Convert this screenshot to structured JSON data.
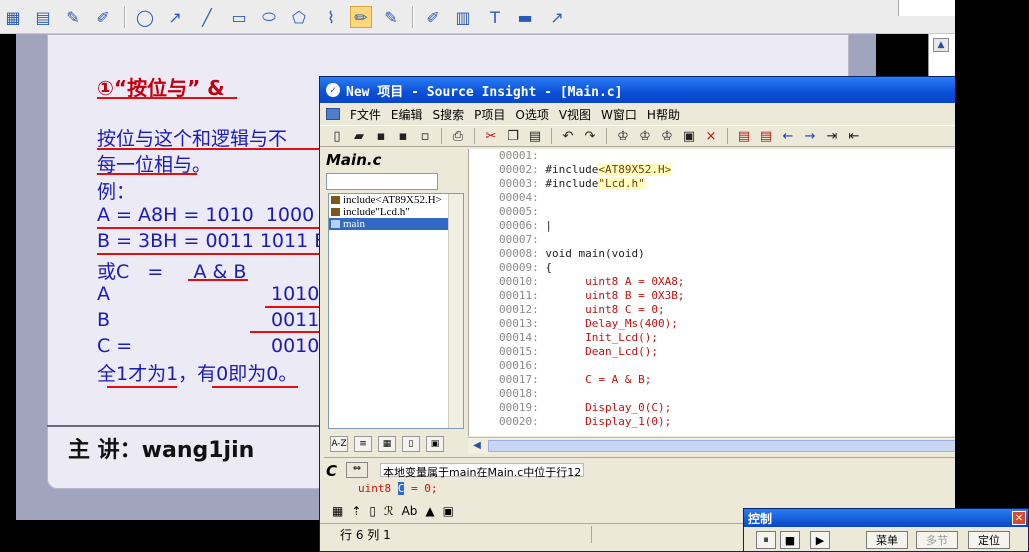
{
  "si_window": {
    "title": "New 项目 - Source Insight - [Main.c]",
    "menu": [
      "F文件",
      "E编辑",
      "S搜索",
      "P项目",
      "O选项",
      "V视图",
      "W窗口",
      "H帮助"
    ],
    "symbol_title": "Main.c",
    "symbols": [
      "include<AT89X52.H>",
      "include\"Lcd.h\"",
      "main"
    ],
    "code_lines": [
      {
        "num": "00001:",
        "text": ""
      },
      {
        "num": "00002:",
        "text": "#include<AT89X52.H>"
      },
      {
        "num": "00003:",
        "text": "#include\"Lcd.h\""
      },
      {
        "num": "00004:",
        "text": ""
      },
      {
        "num": "00005:",
        "text": ""
      },
      {
        "num": "00006:",
        "text": "|"
      },
      {
        "num": "00007:",
        "text": ""
      },
      {
        "num": "00008:",
        "text": "void main(void)"
      },
      {
        "num": "00009:",
        "text": "{"
      },
      {
        "num": "00010:",
        "text": "uint8 A = 0XA8;"
      },
      {
        "num": "00011:",
        "text": "uint8 B = 0X3B;"
      },
      {
        "num": "00012:",
        "text": "uint8 C = 0;"
      },
      {
        "num": "00013:",
        "text": "Delay_Ms(400);"
      },
      {
        "num": "00014:",
        "text": "Init_Lcd();"
      },
      {
        "num": "00015:",
        "text": "Dean_Lcd();"
      },
      {
        "num": "00016:",
        "text": ""
      },
      {
        "num": "00017:",
        "text": "C = A & B;"
      },
      {
        "num": "00018:",
        "text": ""
      },
      {
        "num": "00019:",
        "text": "Display_0(C);"
      },
      {
        "num": "00020:",
        "text": "Display_1(0);"
      }
    ],
    "context_label": "C",
    "context_text": "本地变量属于main在Main.c中位于行12",
    "context_code_before": "uint8 ",
    "context_code_sel": "C",
    "context_code_after": " = 0;",
    "status": "行 6  列 1"
  },
  "slide": {
    "title": "①“按位与” &",
    "line1": "按位与这个和逻辑与不",
    "line2": "每一位相与。",
    "line3": "例：",
    "line4": "A = A8H = 1010  1000",
    "line5": "B = 3BH = 0011 1011 B",
    "line6": "或C   =     A & B",
    "row_a_label": "A",
    "row_a_val": "1010",
    "row_b_label": "B",
    "row_b_val": "0011",
    "row_c_label": "C =",
    "row_c_val": "0010",
    "rule": "全1才为1，有0即为0。",
    "footer": "主 讲：wang1jin"
  },
  "control": {
    "title": "控制",
    "btn_menu": "菜单",
    "btn_multi": "多节",
    "btn_locate": "定位"
  }
}
